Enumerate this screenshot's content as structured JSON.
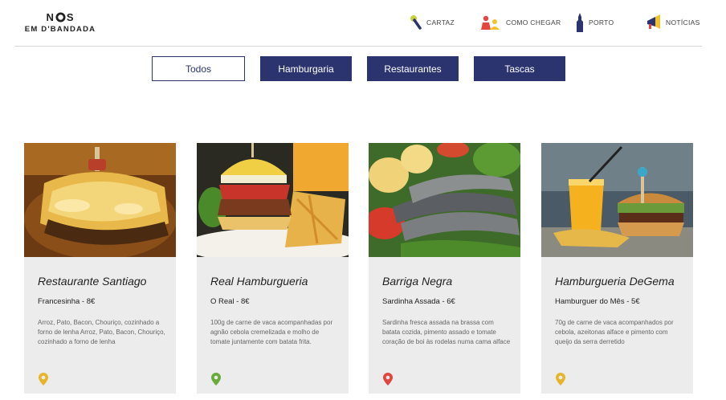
{
  "logo": {
    "line1_a": "N",
    "line1_b": "S",
    "line2": "EM D'BANDADA"
  },
  "nav": [
    {
      "label": "CARTAZ",
      "icon": "microphone-icon"
    },
    {
      "label": "COMO CHEGAR",
      "icon": "people-icon"
    },
    {
      "label": "PORTO",
      "icon": "tower-icon"
    },
    {
      "label": "NOTÍCIAS",
      "icon": "megaphone-icon"
    }
  ],
  "filters": [
    {
      "label": "Todos",
      "active": true
    },
    {
      "label": "Hamburgaria",
      "active": false
    },
    {
      "label": "Restaurantes",
      "active": false
    },
    {
      "label": "Tascas",
      "active": false
    }
  ],
  "cards": [
    {
      "title": "Restaurante Santiago",
      "price": "Francesinha - 8€",
      "description": "Arroz, Pato, Bacon, Chouriço, cozinhado a forno de lenha Arroz, Pato, Bacon, Chouriço, cozinhado a forno de lenha",
      "pin_color": "#e6b52a",
      "image": "francesinha-photo"
    },
    {
      "title": "Real Hamburgueria",
      "price": "O Real - 8€",
      "description": "100g de carne de vaca acompanhadas por agnão cebola cremelizada e molho de tomate juntamente com batata frita.",
      "pin_color": "#6aaa3a",
      "image": "burger-fries-photo"
    },
    {
      "title": "Barriga Negra",
      "price": "Sardinha Assada - 6€",
      "description": "Sardinha fresca assada na brassa com batata cozida, pimento assado e tomate coração de boi às rodelas numa cama alface",
      "pin_color": "#e2463e",
      "image": "grilled-sardines-photo"
    },
    {
      "title": "Hamburgueria DeGema",
      "price": "Hamburguer do Mês - 5€",
      "description": "70g de carne de vaca acompanhados por cebola, azeitonas alface e pimento com queijo da serra derretido",
      "pin_color": "#e6b52a",
      "image": "burger-juice-photo"
    }
  ],
  "colors": {
    "brand_navy": "#2c3470",
    "card_bg": "#ececec"
  }
}
